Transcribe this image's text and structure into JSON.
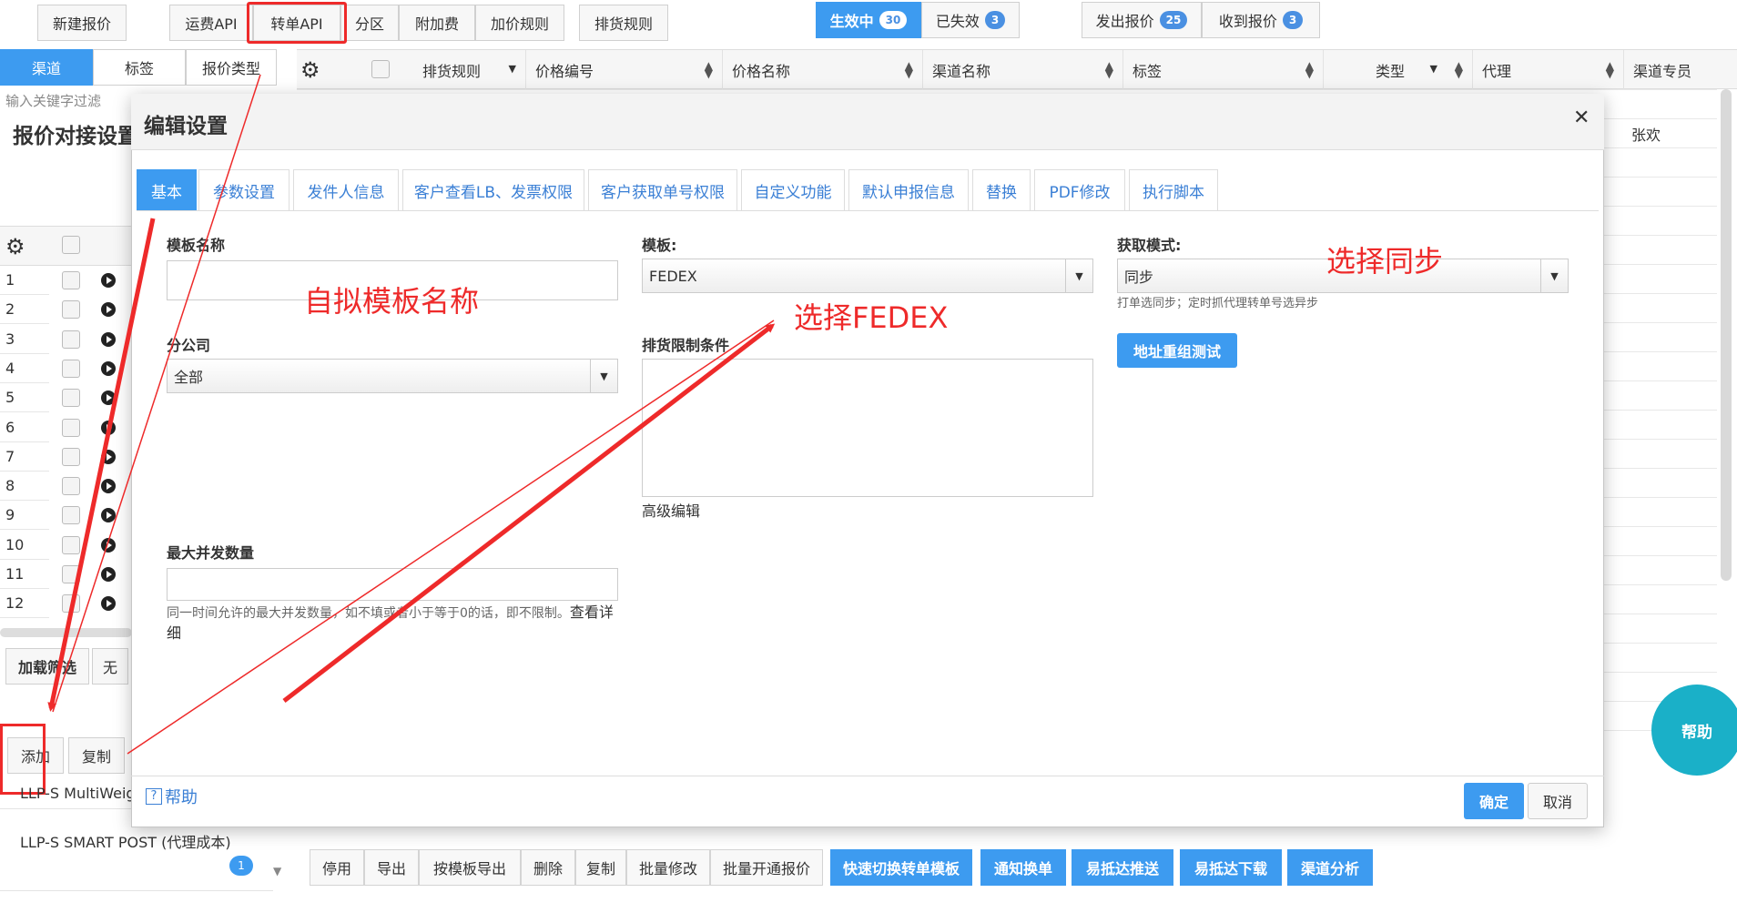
{
  "toolbar": {
    "new_quote": "新建报价",
    "tabs": [
      "运费API",
      "转单API",
      "分区",
      "附加费",
      "加价规则"
    ],
    "routing_rules": "排货规则",
    "status_active": "生效中",
    "status_active_count": "30",
    "status_expired": "已失效",
    "status_expired_count": "3",
    "sent_quote": "发出报价",
    "sent_quote_count": "25",
    "received_quote": "收到报价",
    "received_quote_count": "3"
  },
  "left_panel": {
    "tabs": [
      "渠道",
      "标签",
      "报价类型"
    ],
    "filter_placeholder": "输入关键字过滤",
    "title": "报价对接设置",
    "rows": [
      "1",
      "2",
      "3",
      "4",
      "5",
      "6",
      "7",
      "8",
      "9",
      "10",
      "11",
      "12"
    ],
    "load_filter": "加载筛选",
    "none": "无",
    "add": "添加",
    "copy": "复制",
    "item1": "LLP-S MultiWeig",
    "item2": "LLP-S SMART POST (代理成本)",
    "item2_badge": "1"
  },
  "grid": {
    "columns": [
      "排货规则",
      "价格编号",
      "价格名称",
      "渠道名称",
      "标签",
      "类型",
      "代理",
      "渠道专员"
    ],
    "cell_agent": "张欢"
  },
  "modal": {
    "title": "编辑设置",
    "tabs": [
      "基本",
      "参数设置",
      "发件人信息",
      "客户查看LB、发票权限",
      "客户获取单号权限",
      "自定义功能",
      "默认申报信息",
      "替换",
      "PDF修改",
      "执行脚本"
    ],
    "template_name_label": "模板名称",
    "template_label": "模板:",
    "template_value": "FEDEX",
    "fetch_mode_label": "获取模式:",
    "fetch_mode_value": "同步",
    "fetch_mode_hint": "打单选同步；定时抓代理转单号选异步",
    "address_test": "地址重组测试",
    "branch_label": "分公司",
    "branch_value": "全部",
    "routing_limit_label": "排货限制条件",
    "advanced_edit": "高级编辑",
    "max_concurrency_label": "最大并发数量",
    "max_concurrency_hint": "同一时间允许的最大并发数量，如不填或者小于等于0的话，即不限制。",
    "view_detail": "查看详细",
    "help": "帮助",
    "ok": "确定",
    "cancel": "取消"
  },
  "bottom_bar": {
    "buttons": [
      "停用",
      "导出",
      "按模板导出",
      "删除",
      "复制",
      "批量修改",
      "批量开通报价"
    ],
    "blue_buttons": [
      "快速切换转单模板",
      "通知换单",
      "易抵达推送",
      "易抵达下载",
      "渠道分析"
    ]
  },
  "help_fab": "帮助",
  "annotations": {
    "name_hint": "自拟模板名称",
    "fedex_hint": "选择FEDEX",
    "sync_hint": "选择同步"
  },
  "colors": {
    "accent": "#3d9bf0",
    "annotation": "#ee2a2a",
    "help_fab": "#1ab0c8"
  }
}
